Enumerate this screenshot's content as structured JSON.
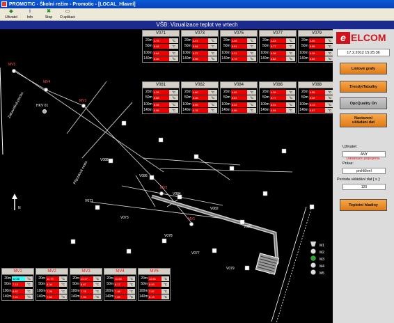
{
  "window": {
    "title": "PROMOTIC - Školní režim - Promotic - [LOCAL_Hlavní]"
  },
  "toolbar": {
    "buttons": [
      {
        "label": "Uživatel",
        "icon": "user-icon"
      },
      {
        "label": "Info",
        "icon": "info-icon"
      },
      {
        "label": "Stop",
        "icon": "stop-icon"
      },
      {
        "label": "O aplikaci",
        "icon": "about-icon"
      }
    ]
  },
  "header": {
    "title": "VŠB: Vizualizace teplot ve vrtech"
  },
  "map": {
    "labels": {
      "area": "Zatravněná plocha",
      "road": "Příjezdová cesta",
      "hkv": "HKV 01",
      "north": "N"
    },
    "mv_points": [
      "MV5",
      "MV4",
      "MV3",
      "MV2",
      "MV1"
    ],
    "v_points": [
      "V088",
      "V086",
      "V084",
      "V082",
      "V081",
      "V077",
      "V079",
      "V073",
      "V071",
      "V078"
    ],
    "legend": [
      "M1",
      "M2",
      "M3",
      "M4",
      "M5"
    ]
  },
  "depths": [
    "20m",
    "50m",
    "100m",
    "140m"
  ],
  "unit": "°C",
  "top_tables": [
    {
      "name": "V071",
      "values": [
        "4.79",
        "5.45",
        "5.84",
        "6.26"
      ]
    },
    {
      "name": "V073",
      "values": [
        "4.41",
        "5.54",
        "6.37",
        "6.98"
      ]
    },
    {
      "name": "V075",
      "values": [
        "4.46",
        "5.51",
        "6.21",
        "6.79"
      ]
    },
    {
      "name": "V077",
      "values": [
        "4.23",
        "5.77",
        "6.38",
        "6.84"
      ]
    },
    {
      "name": "V079",
      "values": [
        "4.65",
        "5.85",
        "6.39",
        "6.89"
      ]
    },
    {
      "name": "V081",
      "values": [
        "4.28",
        "5.68",
        "6.35",
        "6.98"
      ]
    },
    {
      "name": "V082",
      "values": [
        "4.60",
        "5.26",
        "6.09",
        "6.76"
      ]
    },
    {
      "name": "V084",
      "values": [
        "4.92",
        "5.61",
        "6.22",
        "6.86"
      ]
    },
    {
      "name": "V086",
      "values": [
        "4.39",
        "5.77",
        "6.31",
        "6.94"
      ]
    },
    {
      "name": "V088",
      "values": [
        "4.55",
        "5.39",
        "6.13",
        "6.87"
      ]
    }
  ],
  "bottom_tables": [
    {
      "name": "MV1",
      "values": [
        "10.88",
        "7.13",
        "6.82",
        "7.21"
      ]
    },
    {
      "name": "MV2",
      "values": [
        "11.73",
        "8.04",
        "7.26",
        "7.54"
      ]
    },
    {
      "name": "MV3",
      "values": [
        "12.27",
        "8.67",
        "7.78",
        "7.94"
      ]
    },
    {
      "name": "MV4",
      "values": [
        "11.96",
        "8.17",
        "7.48",
        "7.69"
      ]
    },
    {
      "name": "MV5",
      "values": [
        "12.61",
        "8.93",
        "7.97",
        "8.13"
      ]
    }
  ],
  "panel": {
    "logo_text": "ELCOM",
    "datetime": "17.2.2012 15:25:36",
    "btn_graphs": "Liniové grafy",
    "btn_trends": "Trendy/Tabulky",
    "btn_opc": "OpcQuality On",
    "btn_settings_1": "Nastavení",
    "btn_settings_2": "ukládání dat",
    "db_status": "Databáze připojena.",
    "user_label": "Uživatel:",
    "user_value": "ANY",
    "rights_label": "Práva:",
    "rights_value": "prohlížení",
    "period_label": "Perioda ukládání dat [ s ]:",
    "period_value": "120",
    "btn_levels": "Teplotní hladiny"
  },
  "colors": {
    "alarm": "#e00000",
    "ok": "#33ffff",
    "header": "#1b2a8d",
    "button": "#f0952f"
  }
}
